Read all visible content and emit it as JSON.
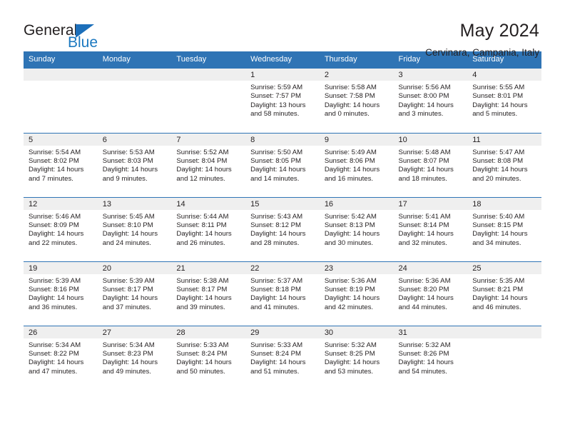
{
  "brand": {
    "name_part1": "General",
    "name_part2": "Blue",
    "logo_icon": "triangle-logo-icon",
    "accent_color": "#1c79c0"
  },
  "header": {
    "title": "May 2024",
    "subtitle": "Cervinara, Campania, Italy"
  },
  "theme": {
    "header_row_color": "#2f74b5",
    "daynum_band_color": "#efefef",
    "text_color": "#231f20"
  },
  "calendar": {
    "weekday_headers": [
      "Sunday",
      "Monday",
      "Tuesday",
      "Wednesday",
      "Thursday",
      "Friday",
      "Saturday"
    ],
    "weeks": [
      [
        {
          "day": "",
          "lines": ""
        },
        {
          "day": "",
          "lines": ""
        },
        {
          "day": "",
          "lines": ""
        },
        {
          "day": "1",
          "lines": "Sunrise: 5:59 AM\nSunset: 7:57 PM\nDaylight: 13 hours\nand 58 minutes."
        },
        {
          "day": "2",
          "lines": "Sunrise: 5:58 AM\nSunset: 7:58 PM\nDaylight: 14 hours\nand 0 minutes."
        },
        {
          "day": "3",
          "lines": "Sunrise: 5:56 AM\nSunset: 8:00 PM\nDaylight: 14 hours\nand 3 minutes."
        },
        {
          "day": "4",
          "lines": "Sunrise: 5:55 AM\nSunset: 8:01 PM\nDaylight: 14 hours\nand 5 minutes."
        }
      ],
      [
        {
          "day": "5",
          "lines": "Sunrise: 5:54 AM\nSunset: 8:02 PM\nDaylight: 14 hours\nand 7 minutes."
        },
        {
          "day": "6",
          "lines": "Sunrise: 5:53 AM\nSunset: 8:03 PM\nDaylight: 14 hours\nand 9 minutes."
        },
        {
          "day": "7",
          "lines": "Sunrise: 5:52 AM\nSunset: 8:04 PM\nDaylight: 14 hours\nand 12 minutes."
        },
        {
          "day": "8",
          "lines": "Sunrise: 5:50 AM\nSunset: 8:05 PM\nDaylight: 14 hours\nand 14 minutes."
        },
        {
          "day": "9",
          "lines": "Sunrise: 5:49 AM\nSunset: 8:06 PM\nDaylight: 14 hours\nand 16 minutes."
        },
        {
          "day": "10",
          "lines": "Sunrise: 5:48 AM\nSunset: 8:07 PM\nDaylight: 14 hours\nand 18 minutes."
        },
        {
          "day": "11",
          "lines": "Sunrise: 5:47 AM\nSunset: 8:08 PM\nDaylight: 14 hours\nand 20 minutes."
        }
      ],
      [
        {
          "day": "12",
          "lines": "Sunrise: 5:46 AM\nSunset: 8:09 PM\nDaylight: 14 hours\nand 22 minutes."
        },
        {
          "day": "13",
          "lines": "Sunrise: 5:45 AM\nSunset: 8:10 PM\nDaylight: 14 hours\nand 24 minutes."
        },
        {
          "day": "14",
          "lines": "Sunrise: 5:44 AM\nSunset: 8:11 PM\nDaylight: 14 hours\nand 26 minutes."
        },
        {
          "day": "15",
          "lines": "Sunrise: 5:43 AM\nSunset: 8:12 PM\nDaylight: 14 hours\nand 28 minutes."
        },
        {
          "day": "16",
          "lines": "Sunrise: 5:42 AM\nSunset: 8:13 PM\nDaylight: 14 hours\nand 30 minutes."
        },
        {
          "day": "17",
          "lines": "Sunrise: 5:41 AM\nSunset: 8:14 PM\nDaylight: 14 hours\nand 32 minutes."
        },
        {
          "day": "18",
          "lines": "Sunrise: 5:40 AM\nSunset: 8:15 PM\nDaylight: 14 hours\nand 34 minutes."
        }
      ],
      [
        {
          "day": "19",
          "lines": "Sunrise: 5:39 AM\nSunset: 8:16 PM\nDaylight: 14 hours\nand 36 minutes."
        },
        {
          "day": "20",
          "lines": "Sunrise: 5:39 AM\nSunset: 8:17 PM\nDaylight: 14 hours\nand 37 minutes."
        },
        {
          "day": "21",
          "lines": "Sunrise: 5:38 AM\nSunset: 8:17 PM\nDaylight: 14 hours\nand 39 minutes."
        },
        {
          "day": "22",
          "lines": "Sunrise: 5:37 AM\nSunset: 8:18 PM\nDaylight: 14 hours\nand 41 minutes."
        },
        {
          "day": "23",
          "lines": "Sunrise: 5:36 AM\nSunset: 8:19 PM\nDaylight: 14 hours\nand 42 minutes."
        },
        {
          "day": "24",
          "lines": "Sunrise: 5:36 AM\nSunset: 8:20 PM\nDaylight: 14 hours\nand 44 minutes."
        },
        {
          "day": "25",
          "lines": "Sunrise: 5:35 AM\nSunset: 8:21 PM\nDaylight: 14 hours\nand 46 minutes."
        }
      ],
      [
        {
          "day": "26",
          "lines": "Sunrise: 5:34 AM\nSunset: 8:22 PM\nDaylight: 14 hours\nand 47 minutes."
        },
        {
          "day": "27",
          "lines": "Sunrise: 5:34 AM\nSunset: 8:23 PM\nDaylight: 14 hours\nand 49 minutes."
        },
        {
          "day": "28",
          "lines": "Sunrise: 5:33 AM\nSunset: 8:24 PM\nDaylight: 14 hours\nand 50 minutes."
        },
        {
          "day": "29",
          "lines": "Sunrise: 5:33 AM\nSunset: 8:24 PM\nDaylight: 14 hours\nand 51 minutes."
        },
        {
          "day": "30",
          "lines": "Sunrise: 5:32 AM\nSunset: 8:25 PM\nDaylight: 14 hours\nand 53 minutes."
        },
        {
          "day": "31",
          "lines": "Sunrise: 5:32 AM\nSunset: 8:26 PM\nDaylight: 14 hours\nand 54 minutes."
        },
        {
          "day": "",
          "lines": ""
        }
      ]
    ]
  }
}
